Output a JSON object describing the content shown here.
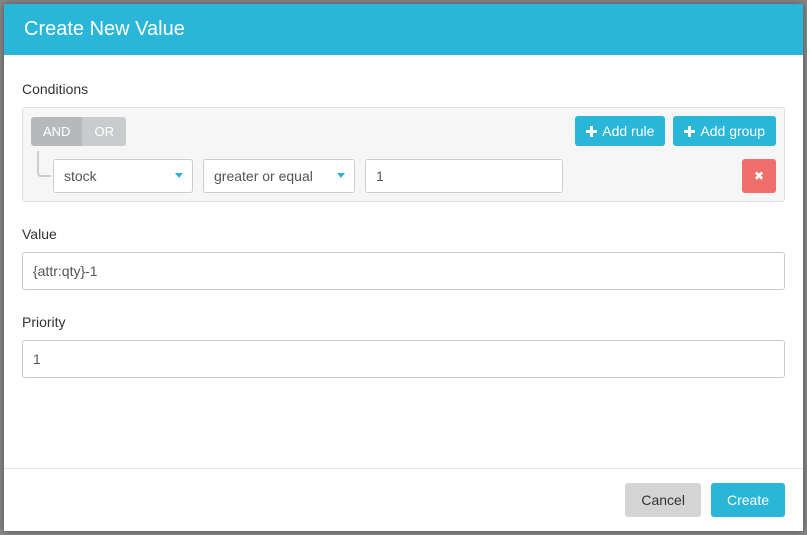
{
  "header": {
    "title": "Create New Value"
  },
  "conditions": {
    "label": "Conditions",
    "and_label": "AND",
    "or_label": "OR",
    "add_rule_label": "Add rule",
    "add_group_label": "Add group",
    "rule": {
      "field_value": "stock",
      "operator_value": "greater or equal",
      "input_value": "1"
    }
  },
  "value": {
    "label": "Value",
    "input_value": "{attr:qty}-1"
  },
  "priority": {
    "label": "Priority",
    "input_value": "1"
  },
  "footer": {
    "cancel_label": "Cancel",
    "create_label": "Create"
  }
}
